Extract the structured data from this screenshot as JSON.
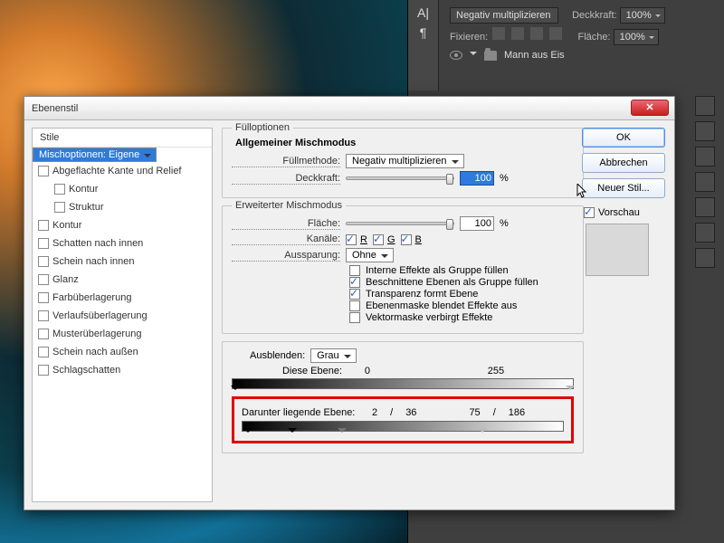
{
  "side_panel": {
    "blend_mode": "Negativ multiplizieren",
    "opacity_label": "Deckkraft:",
    "opacity_value": "100%",
    "lock_label": "Fixieren:",
    "fill_label": "Fläche:",
    "fill_value": "100%",
    "layer_name": "Mann aus Eis"
  },
  "dialog": {
    "title": "Ebenenstil",
    "close_glyph": "✕",
    "styles_header": "Stile",
    "styles": [
      {
        "label": "Mischoptionen: Eigene",
        "selected": true,
        "cb": false
      },
      {
        "label": "Abgeflachte Kante und Relief",
        "cb": true
      },
      {
        "label": "Kontur",
        "cb": true,
        "indent": true
      },
      {
        "label": "Struktur",
        "cb": true,
        "indent": true
      },
      {
        "label": "Kontur",
        "cb": true
      },
      {
        "label": "Schatten nach innen",
        "cb": true
      },
      {
        "label": "Schein nach innen",
        "cb": true
      },
      {
        "label": "Glanz",
        "cb": true
      },
      {
        "label": "Farbüberlagerung",
        "cb": true
      },
      {
        "label": "Verlaufsüberlagerung",
        "cb": true
      },
      {
        "label": "Musterüberlagerung",
        "cb": true
      },
      {
        "label": "Schein nach außen",
        "cb": true
      },
      {
        "label": "Schlagschatten",
        "cb": true
      }
    ],
    "fill_group": "Fülloptionen",
    "general_header": "Allgemeiner Mischmodus",
    "fill_method_label": "Füllmethode:",
    "fill_method_value": "Negativ multiplizieren",
    "opacity_label": "Deckkraft:",
    "opacity_value": "100",
    "percent": "%",
    "adv_header": "Erweiterter Mischmodus",
    "area_label": "Fläche:",
    "area_value": "100",
    "channels_label": "Kanäle:",
    "ch_r": "R",
    "ch_g": "G",
    "ch_b": "B",
    "knockout_label": "Aussparung:",
    "knockout_value": "Ohne",
    "adv_checks": [
      {
        "label": "Interne Effekte als Gruppe füllen",
        "ck": false
      },
      {
        "label": "Beschnittene Ebenen als Gruppe füllen",
        "ck": true
      },
      {
        "label": "Transparenz formt Ebene",
        "ck": true
      },
      {
        "label": "Ebenenmaske blendet Effekte aus",
        "ck": false
      },
      {
        "label": "Vektormaske verbirgt Effekte",
        "ck": false
      }
    ],
    "blendif_label": "Ausblenden:",
    "blendif_value": "Grau",
    "this_layer_label": "Diese Ebene:",
    "this_black": "0",
    "this_white": "255",
    "under_layer_label": "Darunter liegende Ebene:",
    "under_b1": "2",
    "under_b2": "36",
    "under_w1": "75",
    "under_w2": "186",
    "slash": "/",
    "buttons": {
      "ok": "OK",
      "cancel": "Abbrechen",
      "new_style": "Neuer Stil...",
      "preview": "Vorschau"
    }
  }
}
